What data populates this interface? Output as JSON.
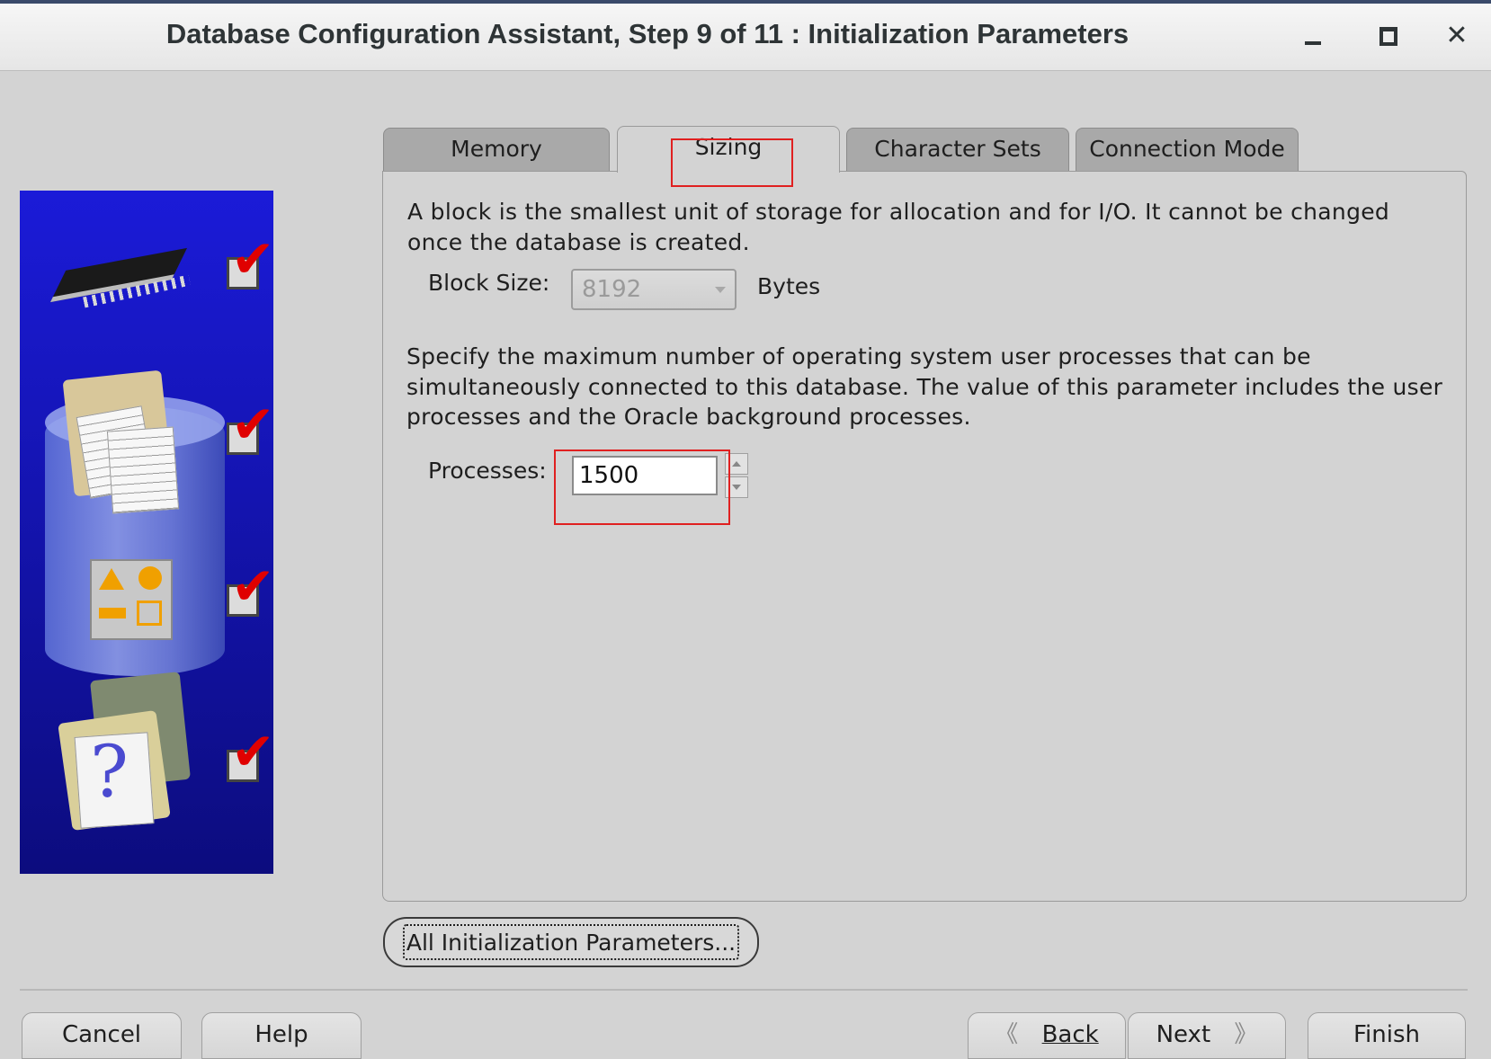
{
  "window": {
    "title": "Database Configuration Assistant, Step 9 of 11 : Initialization Parameters",
    "controls": {
      "minimize": "minimize-icon",
      "maximize": "maximize-icon",
      "close": "close-icon"
    }
  },
  "tabs": [
    {
      "label": "Memory",
      "active": false
    },
    {
      "label": "Sizing",
      "active": true
    },
    {
      "label": "Character Sets",
      "active": false
    },
    {
      "label": "Connection Mode",
      "active": false
    }
  ],
  "sizing": {
    "block_description": "A block is the smallest unit of storage for allocation and for I/O. It cannot be changed once the database is created.",
    "block_size_label": "Block Size:",
    "block_size_value": "8192",
    "block_size_unit": "Bytes",
    "processes_description": "Specify the maximum number of operating system user processes that can be simultaneously connected to this database. The value of this parameter includes the user processes and the Oracle background processes.",
    "processes_label": "Processes:",
    "processes_value": "1500"
  },
  "all_params_button": "All Initialization Parameters...",
  "footer": {
    "cancel": "Cancel",
    "help": "Help",
    "back": "Back",
    "next": "Next",
    "finish": "Finish"
  },
  "colors": {
    "highlight": "#e02020",
    "sidebar": "#1414b0",
    "check": "#e00000"
  }
}
